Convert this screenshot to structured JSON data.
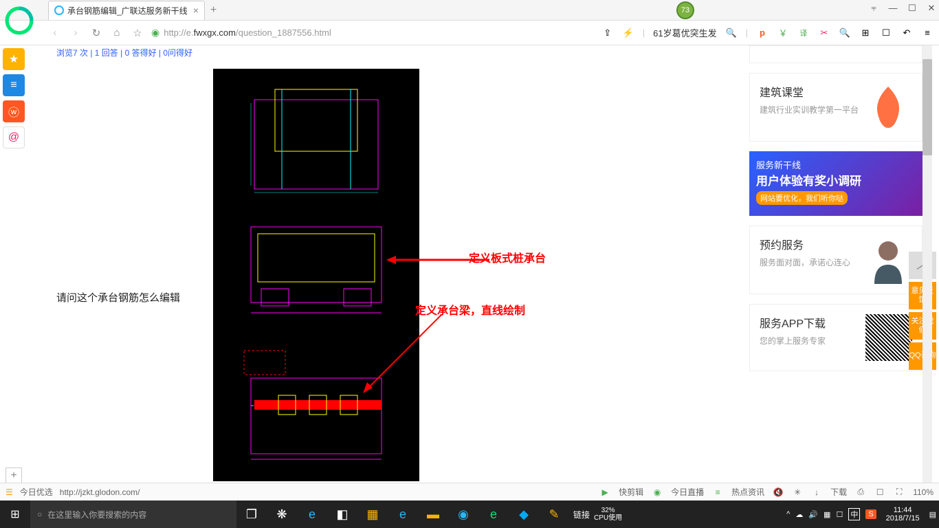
{
  "browser": {
    "tab_title": "承台钢筋编辑_广联达服务新干线",
    "url_prefix": "http://e.",
    "url_domain": "fwxgx.com",
    "url_path": "/question_1887556.html",
    "headline": "61岁葛优突生发",
    "badge": "73"
  },
  "window": {
    "pin": "⫧",
    "min": "—",
    "max": "☐",
    "close": "✕"
  },
  "nav_icons": {
    "back": "‹",
    "fwd": "›",
    "reload": "↻",
    "home": "⌂",
    "star": "☆",
    "share": "⇪",
    "flash": "⚡",
    "search": "🔍",
    "menu": "≡"
  },
  "toolbar_icons": [
    "p",
    "￥",
    "译",
    "✂",
    "🔍",
    "⊞",
    "☐",
    "↶",
    "≡"
  ],
  "leftbar": {
    "star": "★",
    "news": "≡",
    "weibo": "ⓦ",
    "at": "@"
  },
  "page": {
    "meta": "浏览7 次 | 1 回答 | 0 答得好 | 0问得好",
    "question": "请问这个承台钢筋怎么编辑",
    "anno1": "定义板式桩承台",
    "anno2": "定义承台梁，直线绘制"
  },
  "sidebar": {
    "card1": {
      "title": "建筑课堂",
      "desc": "建筑行业实训教学第一平台"
    },
    "banner": {
      "l1": "服务新干线",
      "l2": "用户体验有奖小调研",
      "l3": "网站要优化，我们听你哒"
    },
    "card2": {
      "title": "预约服务",
      "desc": "服务面对面，承诺心连心"
    },
    "card3": {
      "title": "服务APP下载",
      "desc": "您的掌上服务专家"
    }
  },
  "floats": {
    "top": "︿",
    "f1": "意见反馈",
    "f2": "关注我们",
    "f3": "QQ咨询"
  },
  "status": {
    "rec": "今日优选",
    "url": "http://jzkt.glodon.com/",
    "s1": "快剪辑",
    "s2": "今日直播",
    "s3": "热点资讯",
    "dl": "下载",
    "zoom": "110%"
  },
  "taskbar": {
    "search_placeholder": "在这里输入你要搜索的内容",
    "link": "链接",
    "cpu_pct": "32%",
    "cpu_lbl": "CPU使用",
    "ime": "中",
    "sogou": "S",
    "time": "11:44",
    "date": "2018/7/15"
  }
}
